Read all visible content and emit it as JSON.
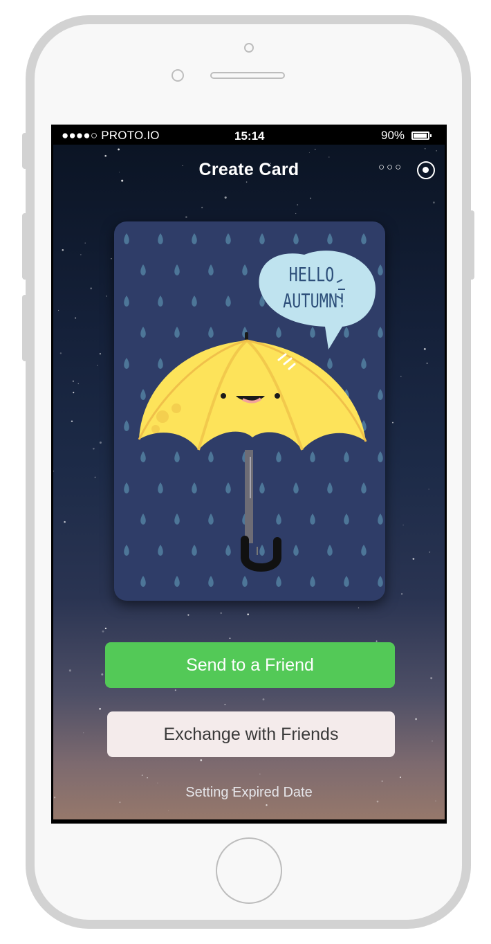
{
  "status_bar": {
    "carrier": "●●●●○ PROTO.IO",
    "time": "15:14",
    "battery": "90%"
  },
  "nav": {
    "title": "Create Card",
    "more_icon": "more-dots-icon",
    "target_icon": "record-target-icon"
  },
  "card": {
    "bubble_line1": "HELLO",
    "bubble_line2": "AUTUMN!",
    "illustration": "smiling-yellow-umbrella-in-rain"
  },
  "actions": {
    "send_label": "Send to a Friend",
    "exchange_label": "Exchange with Friends",
    "expired_label": "Setting Expired Date"
  },
  "colors": {
    "send_button": "#53c957",
    "exchange_button": "#f4ebeb",
    "card_background": "#2f3d68",
    "umbrella": "#fde35a"
  }
}
